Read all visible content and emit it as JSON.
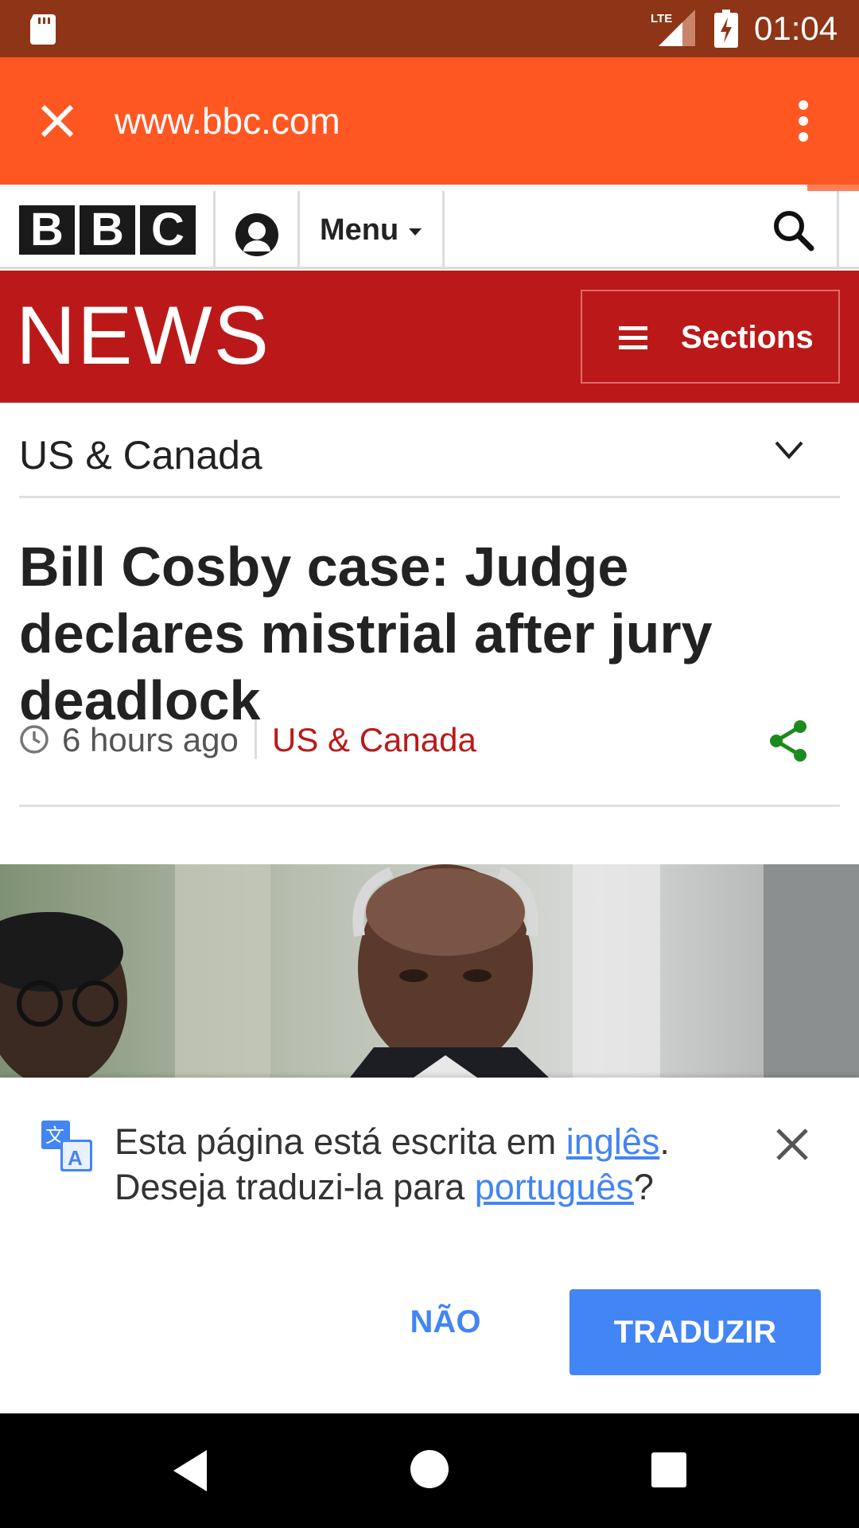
{
  "status_bar": {
    "network": "LTE",
    "time": "01:04"
  },
  "toolbar": {
    "url": "www.bbc.com",
    "page_load_progress": 0.94
  },
  "masthead": {
    "logo_letters": [
      "B",
      "B",
      "C"
    ],
    "menu_label": "Menu"
  },
  "news_bar": {
    "wordmark": "NEWS",
    "sections_label": "Sections"
  },
  "section": {
    "title": "US & Canada"
  },
  "article": {
    "headline": "Bill Cosby case: Judge declares mistrial after jury deadlock",
    "time_ago": "6 hours ago",
    "section_link": "US & Canada"
  },
  "translate": {
    "message_part1": "Esta página está escrita em ",
    "source_language": "inglês",
    "message_part2": ".",
    "message_part3": "Deseja traduzi-la para ",
    "target_language": "português",
    "message_part4": "?",
    "decline_label": "NÃO",
    "accept_label": "TRADUZIR"
  },
  "colors": {
    "status_bar": "#8e3517",
    "toolbar": "#ff5722",
    "bbc_red": "#bb1919",
    "accent_blue": "#4285f4",
    "share_green": "#1d8a1d"
  }
}
